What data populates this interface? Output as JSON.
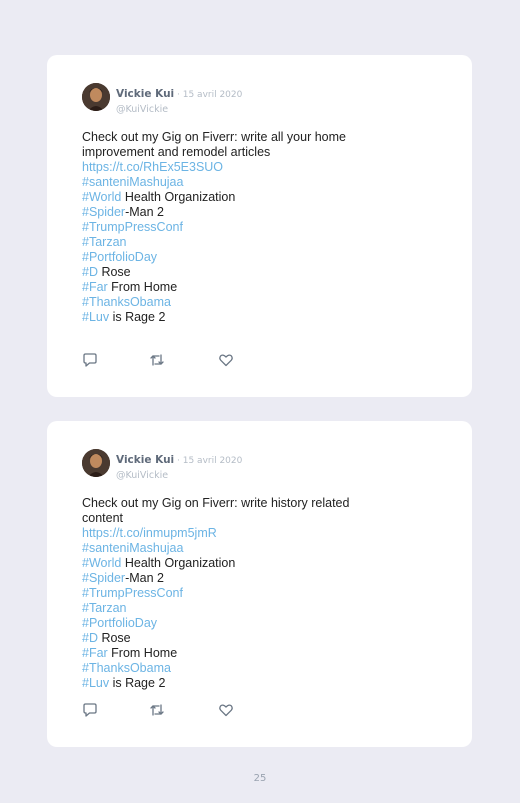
{
  "tweets": [
    {
      "author_name": "Vickie Kui",
      "date": " · 15 avril 2020",
      "handle": "@KuiVickie",
      "text": "Check out my Gig on Fiverr: write all your home improvement and remodel articles",
      "url": "https://t.co/RhEx5E3SUO",
      "hashtags": [
        {
          "tag": "#santeniMashujaa",
          "rest": ""
        },
        {
          "tag": "#World",
          "rest": " Health Organization"
        },
        {
          "tag": "#Spider",
          "rest": "-Man 2"
        },
        {
          "tag": "#TrumpPressConf",
          "rest": ""
        },
        {
          "tag": "#Tarzan",
          "rest": ""
        },
        {
          "tag": "#PortfolioDay",
          "rest": ""
        },
        {
          "tag": "#D",
          "rest": " Rose"
        },
        {
          "tag": "#Far",
          "rest": " From Home"
        },
        {
          "tag": "#ThanksObama",
          "rest": ""
        },
        {
          "tag": "#Luv",
          "rest": " is Rage 2"
        }
      ]
    },
    {
      "author_name": "Vickie Kui",
      "date": " · 15 avril 2020",
      "handle": "@KuiVickie",
      "text": "Check out my Gig on Fiverr: write history related content",
      "url": "https://t.co/inmupm5jmR",
      "hashtags": [
        {
          "tag": "#santeniMashujaa",
          "rest": ""
        },
        {
          "tag": "#World",
          "rest": " Health Organization"
        },
        {
          "tag": "#Spider",
          "rest": "-Man 2"
        },
        {
          "tag": "#TrumpPressConf",
          "rest": ""
        },
        {
          "tag": "#Tarzan",
          "rest": ""
        },
        {
          "tag": "#PortfolioDay",
          "rest": ""
        },
        {
          "tag": "#D",
          "rest": " Rose"
        },
        {
          "tag": "#Far",
          "rest": " From Home"
        },
        {
          "tag": "#ThanksObama",
          "rest": ""
        },
        {
          "tag": "#Luv",
          "rest": " is Rage 2"
        }
      ]
    }
  ],
  "actions": [
    "reply-icon",
    "retweet-icon",
    "like-icon"
  ],
  "page_number": "25",
  "colors": {
    "link": "#6cb4e4",
    "background": "#ebebf3",
    "card": "#ffffff"
  }
}
